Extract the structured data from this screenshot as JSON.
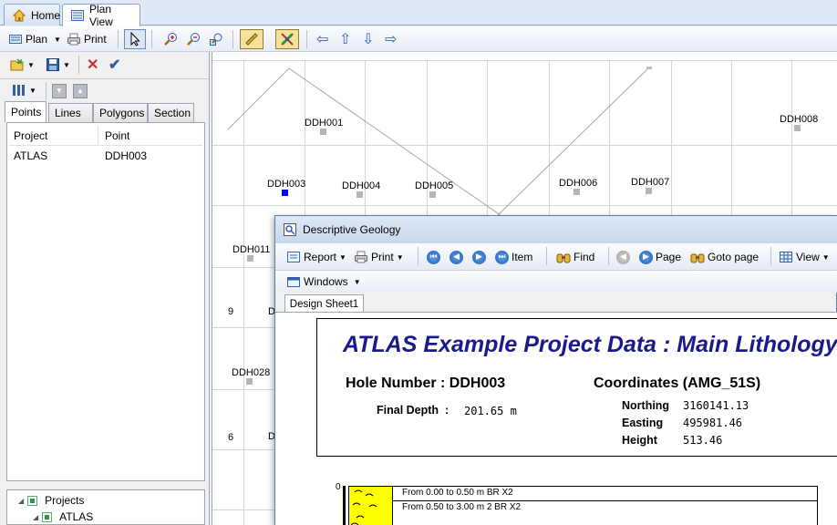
{
  "tabs": {
    "home": "Home",
    "plan_view": "Plan View"
  },
  "toolbar": {
    "plan": "Plan",
    "print": "Print"
  },
  "left_panel": {
    "tabs": [
      "Points",
      "Lines",
      "Polygons",
      "Section"
    ],
    "columns": [
      "Project",
      "Point"
    ],
    "rows": [
      {
        "project": "ATLAS",
        "point": "DDH003"
      }
    ],
    "tree": {
      "root": "Projects",
      "child": "ATLAS"
    }
  },
  "map": {
    "points": [
      {
        "label": "DDH001"
      },
      {
        "label": "DDH003"
      },
      {
        "label": "DDH004"
      },
      {
        "label": "DDH005"
      },
      {
        "label": "DDH006"
      },
      {
        "label": "DDH007"
      },
      {
        "label": "DDH008"
      },
      {
        "label": "DDH011"
      },
      {
        "label": "DDH028"
      }
    ],
    "row_labels": [
      "9",
      "6"
    ],
    "clipped_labels": [
      "D",
      "D"
    ],
    "selected_color": "#0000ff",
    "point_color": "#b4b4b4"
  },
  "dialog": {
    "title": "Descriptive Geology",
    "toolbar": {
      "report": "Report",
      "print": "Print",
      "item": "Item",
      "find": "Find",
      "page": "Page",
      "goto_page": "Goto page",
      "view": "View",
      "windows": "Windows"
    },
    "sheet_tab": "Design Sheet1",
    "report": {
      "title": "ATLAS Example Project Data : Main Lithology",
      "hole_number_label": "Hole Number",
      "hole_number": "DDH003",
      "final_depth_label": "Final Depth",
      "final_depth": "201.65 m",
      "coords_label": "Coordinates (AMG_51S)",
      "northing_label": "Northing",
      "northing": "3160141.13",
      "easting_label": "Easting",
      "easting": "495981.46",
      "height_label": "Height",
      "height": "513.46",
      "depth_axis_zero": "0",
      "intervals": [
        "From 0.00 to 0.50 m BR X2",
        "From 0.50 to 3.00 m 2 BR X2"
      ],
      "litho_color": "#ffff00"
    }
  }
}
